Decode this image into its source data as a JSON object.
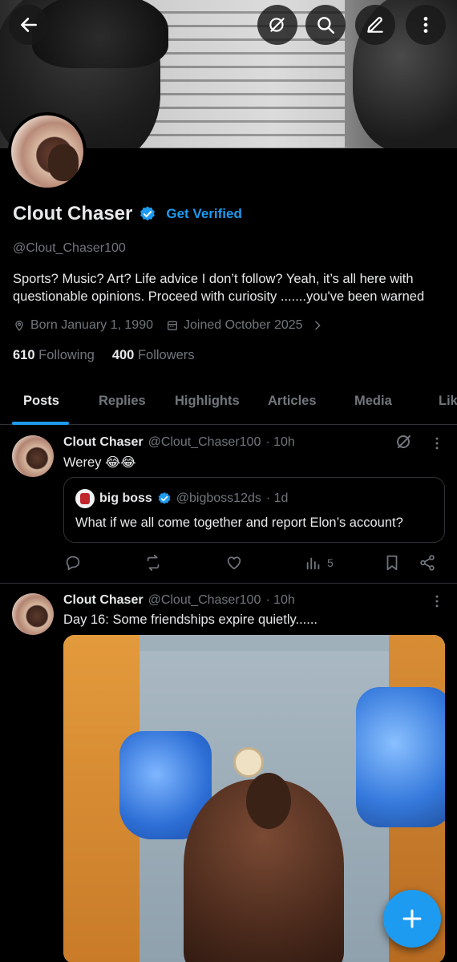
{
  "profile": {
    "name": "Clout Chaser",
    "get_verified": "Get Verified",
    "handle": "@Clout_Chaser100",
    "bio": "Sports? Music? Art? Life advice I don’t follow? Yeah, it’s all here with questionable opinions. Proceed with curiosity .......you've been warned",
    "born": "Born January 1, 1990",
    "joined": "Joined October 2025",
    "following_count": "610",
    "following_label": "Following",
    "followers_count": "400",
    "followers_label": "Followers"
  },
  "tabs": [
    "Posts",
    "Replies",
    "Highlights",
    "Articles",
    "Media",
    "Lik"
  ],
  "active_tab": "Posts",
  "posts": [
    {
      "name": "Clout Chaser",
      "handle": "@Clout_Chaser100",
      "time": "· 10h",
      "text": "Werey 😂😂",
      "quote": {
        "name": "big boss",
        "handle": "@bigboss12ds",
        "time": "· 1d",
        "text": "What if we all come together and report Elon’s account?"
      },
      "views": "5"
    },
    {
      "name": "Clout Chaser",
      "handle": "@Clout_Chaser100",
      "time": "· 10h",
      "text": "Day 16: Some friendships expire quietly......"
    }
  ],
  "colors": {
    "accent": "#1d9bf0",
    "secondary_text": "#71767b",
    "background": "#000000"
  },
  "icons": [
    "back-arrow-icon",
    "grok-icon",
    "search-icon",
    "edit-icon",
    "more-vertical-icon",
    "verified-badge-icon",
    "location-icon",
    "calendar-icon",
    "chevron-right-icon",
    "reply-icon",
    "repost-icon",
    "like-icon",
    "views-icon",
    "bookmark-icon",
    "share-icon",
    "plus-icon"
  ]
}
